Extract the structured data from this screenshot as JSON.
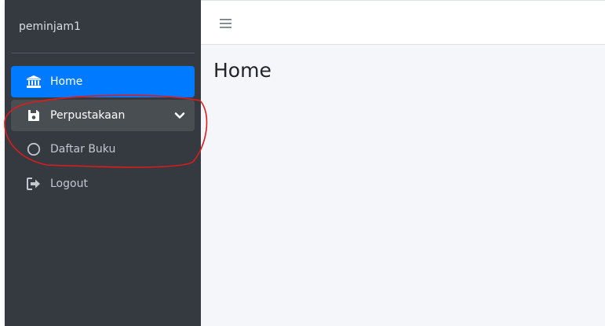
{
  "sidebar": {
    "brand": "peminjam1",
    "items": [
      {
        "label": "Home",
        "icon": "bank-icon",
        "active": true
      },
      {
        "label": "Perpustakaan",
        "icon": "floppy-disk-icon",
        "expanded": true
      },
      {
        "label": "Daftar Buku",
        "icon": "circle-icon"
      },
      {
        "label": "Logout",
        "icon": "sign-out-icon"
      }
    ]
  },
  "header": {
    "menu_icon": "hamburger-icon"
  },
  "main": {
    "title": "Home"
  },
  "colors": {
    "sidebar_bg": "#343a40",
    "active_item": "#007bff",
    "expanded_item": "#494e53",
    "content_bg": "#f4f6f9",
    "annotation": "#e01b1b"
  }
}
